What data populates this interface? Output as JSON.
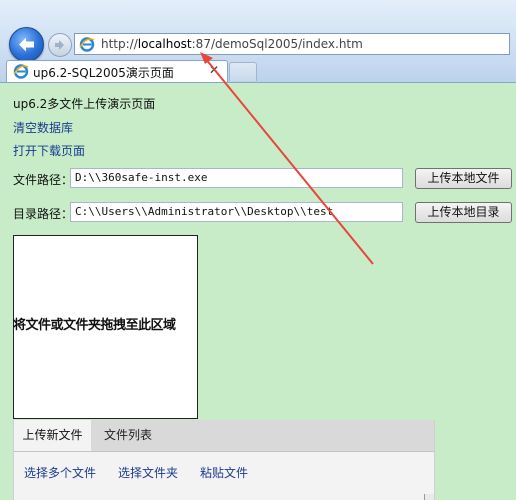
{
  "browser": {
    "address": {
      "prefix": "http://",
      "host": "localhost",
      "rest": ":87/demoSql2005/index.htm"
    },
    "tab": {
      "title": "up6.2-SQL2005演示页面",
      "close": "✕"
    }
  },
  "page": {
    "title": "up6.2多文件上传演示页面",
    "links": {
      "clear_db": "清空数据库",
      "open_download": "打开下载页面"
    },
    "file_path": {
      "label": "文件路径：",
      "value": "D:\\\\360safe-inst.exe",
      "button": "上传本地文件"
    },
    "dir_path": {
      "label": "目录路径：",
      "value": "C:\\\\Users\\\\Administrator\\\\Desktop\\\\test",
      "button": "上传本地目录"
    },
    "drop_zone": {
      "text": "将文件或文件夹拖拽至此区域"
    },
    "panel": {
      "tabs": [
        "上传新文件",
        "文件列表"
      ],
      "actions": [
        "选择多个文件",
        "选择文件夹",
        "粘贴文件"
      ]
    }
  },
  "colors": {
    "page_bg": "#c8ecc8",
    "link": "#1a3c8f",
    "annotation_arrow": "#e8453c"
  }
}
